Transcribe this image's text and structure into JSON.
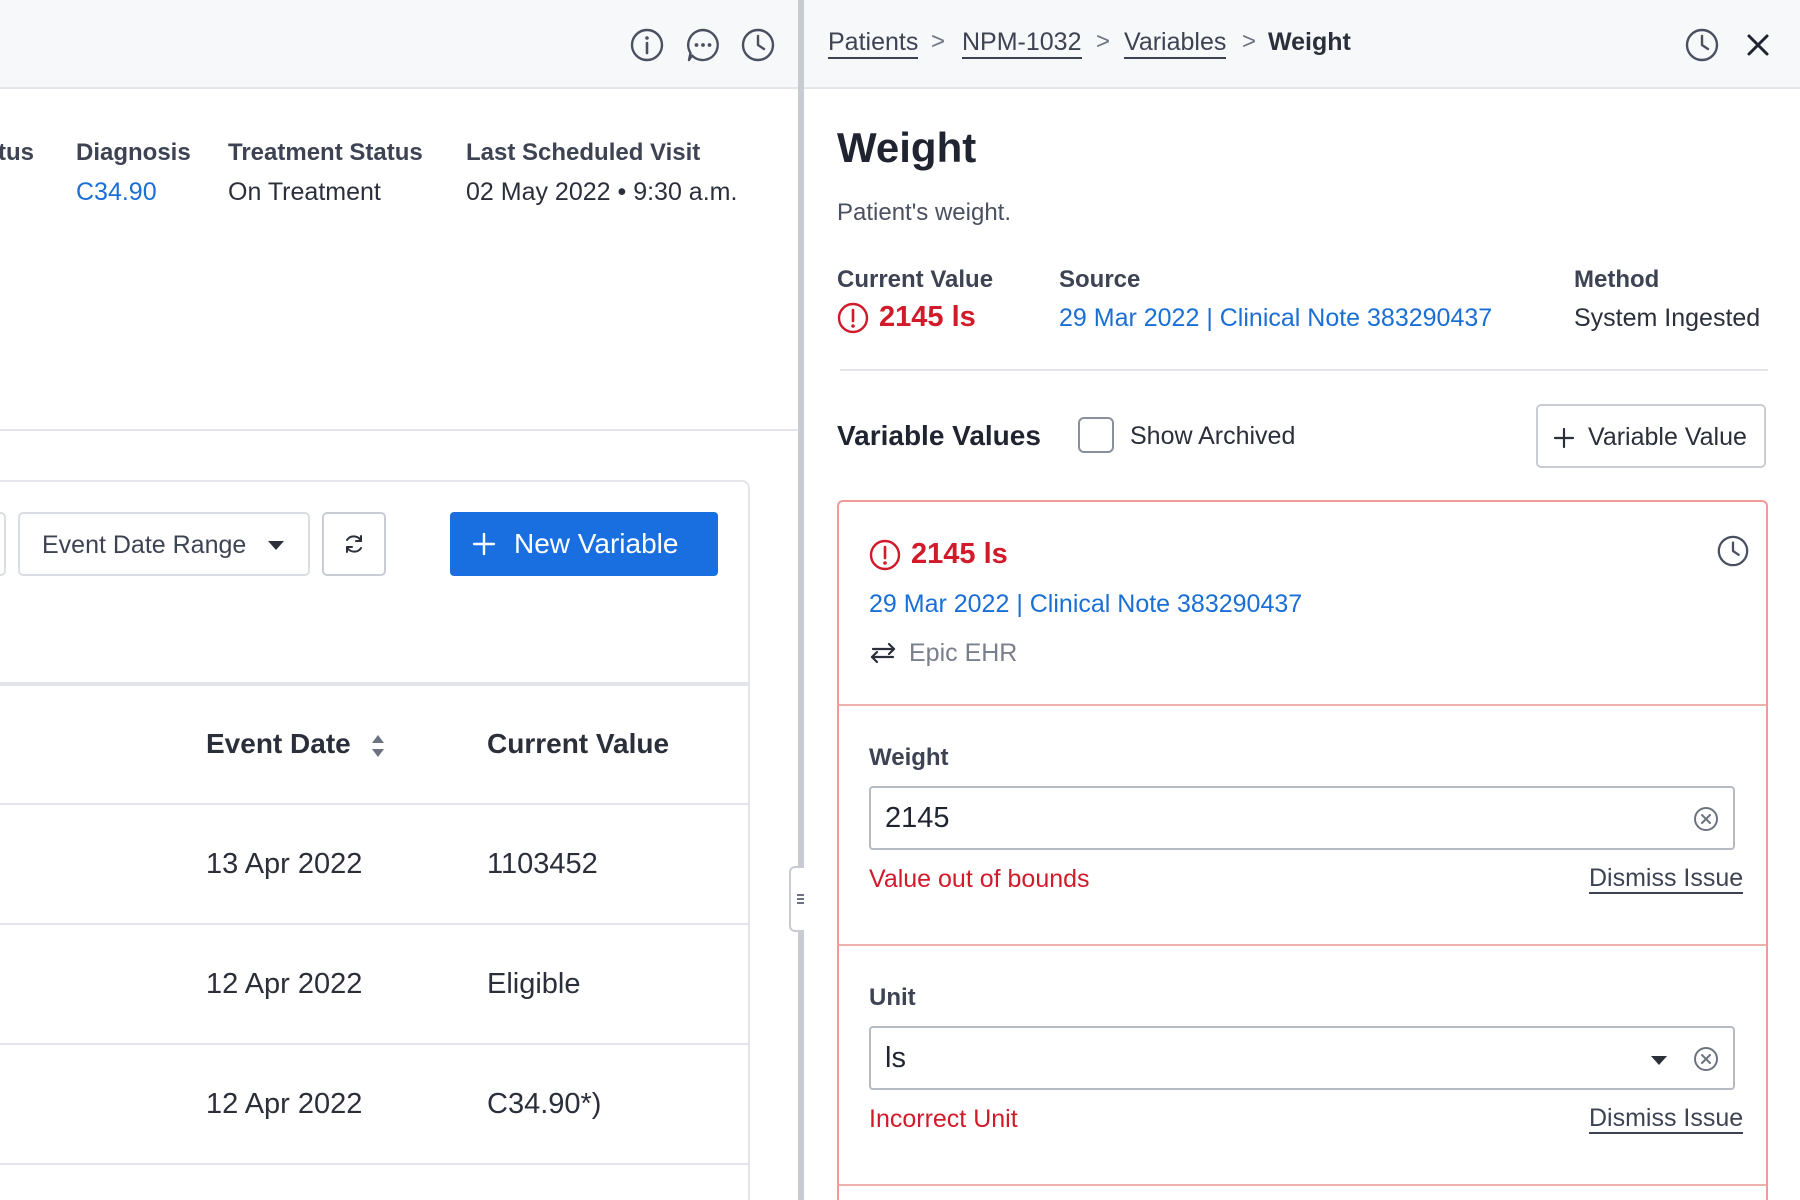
{
  "left": {
    "toolbar": {
      "icons": [
        "info-icon",
        "chat-icon",
        "history-icon"
      ]
    },
    "header": {
      "partial_label": "tus",
      "diagnosis_label": "Diagnosis",
      "diagnosis_value": "C34.90",
      "treatment_label": "Treatment Status",
      "treatment_value": "On Treatment",
      "last_visit_label": "Last Scheduled Visit",
      "last_visit_value": "02 May 2022 • 9:30 a.m."
    },
    "filters": {
      "date_range_label": "Event Date Range",
      "new_variable_label": "New Variable"
    },
    "table": {
      "columns": [
        "Event Date",
        "Current Value"
      ],
      "rows": [
        {
          "date": "13 Apr 2022",
          "value": "1103452"
        },
        {
          "date": "12 Apr 2022",
          "value": "Eligible"
        },
        {
          "date": "12 Apr 2022",
          "value": "C34.90*)"
        }
      ]
    }
  },
  "right": {
    "breadcrumb": [
      "Patients",
      "NPM-1032",
      "Variables",
      "Weight"
    ],
    "title": "Weight",
    "description": "Patient's weight.",
    "current_value_label": "Current Value",
    "current_value": "2145 ls",
    "source_label": "Source",
    "source_value": "29 Mar 2022 | Clinical Note 383290437",
    "method_label": "Method",
    "method_value": "System Ingested",
    "variable_values_title": "Variable Values",
    "show_archived_label": "Show Archived",
    "add_value_label": "Variable Value",
    "card": {
      "value": "2145 ls",
      "source": "29 Mar 2022 | Clinical Note 383290437",
      "origin": "Epic EHR",
      "weight_label": "Weight",
      "weight_value": "2145",
      "weight_error": "Value out of bounds",
      "unit_label": "Unit",
      "unit_value": "ls",
      "unit_error": "Incorrect Unit",
      "dismiss_label": "Dismiss Issue"
    }
  },
  "colors": {
    "link": "#1a6fd6",
    "error": "#d11a2a",
    "primary_button": "#1a6fe0"
  }
}
